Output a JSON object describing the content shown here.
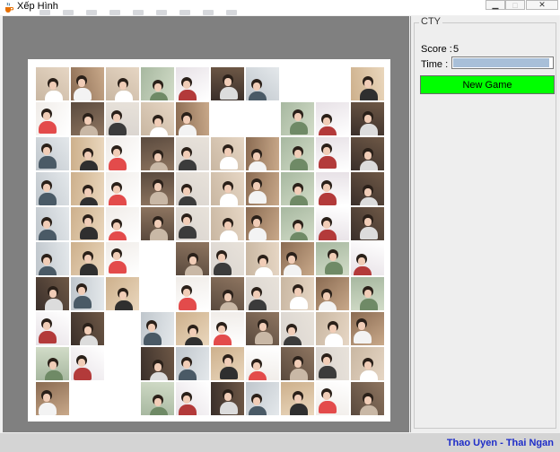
{
  "window": {
    "title": "Xếp Hình",
    "app_icon": "java-cup-icon",
    "controls": [
      "minimize-icon",
      "maximize-icon",
      "close-icon"
    ]
  },
  "board": {
    "rows": 10,
    "cols": 10,
    "tiles": [
      [
        1,
        2,
        1,
        3,
        4,
        5,
        6,
        0,
        0,
        7
      ],
      [
        8,
        9,
        10,
        11,
        12,
        0,
        0,
        13,
        14,
        15
      ],
      [
        16,
        17,
        18,
        19,
        20,
        21,
        22,
        23,
        24,
        25
      ],
      [
        26,
        27,
        28,
        29,
        30,
        31,
        32,
        33,
        34,
        35
      ],
      [
        36,
        37,
        38,
        39,
        40,
        41,
        42,
        43,
        44,
        45
      ],
      [
        46,
        47,
        48,
        0,
        49,
        50,
        51,
        52,
        53,
        54
      ],
      [
        55,
        56,
        57,
        0,
        58,
        59,
        60,
        61,
        62,
        63
      ],
      [
        64,
        65,
        0,
        66,
        67,
        68,
        69,
        70,
        71,
        72
      ],
      [
        73,
        74,
        0,
        75,
        76,
        77,
        78,
        79,
        80,
        81
      ],
      [
        82,
        0,
        0,
        83,
        84,
        85,
        86,
        87,
        88,
        89
      ]
    ]
  },
  "panel": {
    "group_title": "CTY",
    "score_label": "Score :",
    "score_value": "5",
    "time_label": "Time :",
    "time_remaining": 0.97,
    "new_game_label": "New Game",
    "new_game_color": "#00ff00"
  },
  "status": {
    "credit": "Thao Uyen - Thai Ngan",
    "credit_color": "#1e2dc8"
  }
}
